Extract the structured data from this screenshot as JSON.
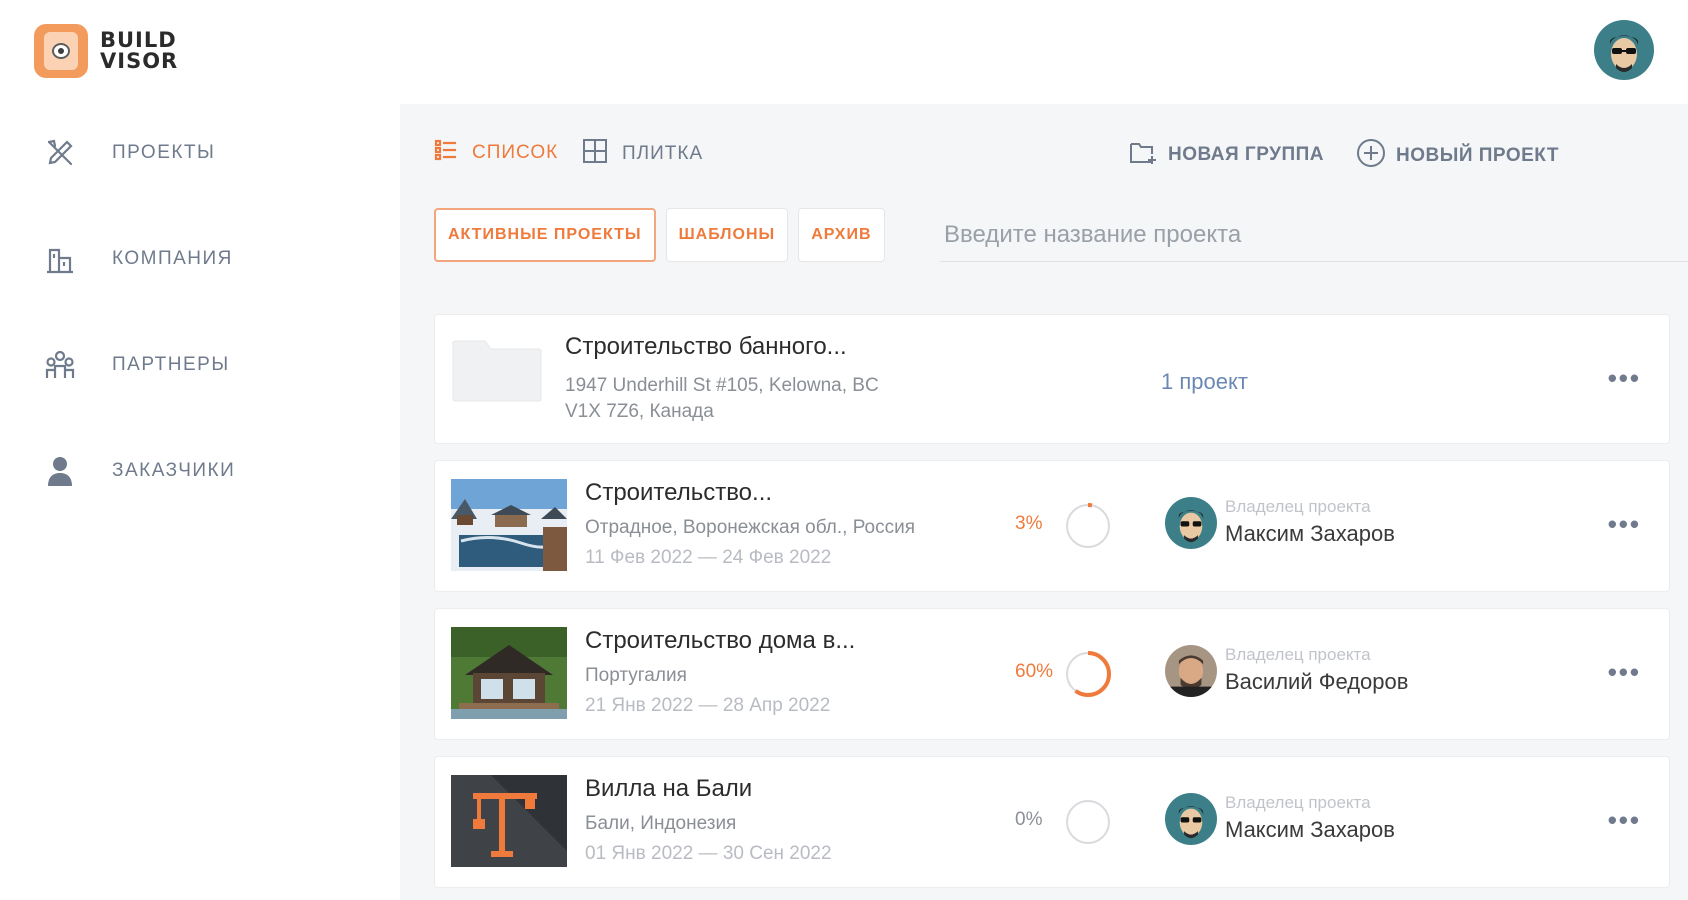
{
  "logo": {
    "line1": "BUILD",
    "line2": "VISOR"
  },
  "sidebar": {
    "items": [
      {
        "label": "ПРОЕКТЫ",
        "icon": "tools-icon"
      },
      {
        "label": "КОМПАНИЯ",
        "icon": "building-icon"
      },
      {
        "label": "ПАРТНЕРЫ",
        "icon": "partners-icon"
      },
      {
        "label": "ЗАКАЗЧИКИ",
        "icon": "customer-icon"
      }
    ]
  },
  "toolbar": {
    "list_label": "СПИСОК",
    "tiles_label": "ПЛИТКА",
    "new_group_label": "НОВАЯ ГРУППА",
    "new_project_label": "НОВЫЙ ПРОЕКТ"
  },
  "filters": [
    {
      "label": "АКТИВНЫЕ ПРОЕКТЫ",
      "active": true
    },
    {
      "label": "ШАБЛОНЫ",
      "active": false
    },
    {
      "label": "АРХИВ",
      "active": false
    }
  ],
  "search": {
    "placeholder": "Введите название проекта",
    "value": ""
  },
  "group": {
    "title": "Строительство банного...",
    "address_line1": "1947 Underhill St #105, Kelowna, BC",
    "address_line2": "V1X 7Z6, Канада",
    "count": "1 проект"
  },
  "projects": [
    {
      "title": "Строительство...",
      "location": "Отрадное, Воронежская обл., Россия",
      "dates": "11 Фев 2022 — 24 Фев 2022",
      "progress_text": "3%",
      "progress": 3,
      "progress_color": "#ef7a3c",
      "owner_label": "Владелец проекта",
      "owner_name": "Максим Захаров"
    },
    {
      "title": "Строительство дома в...",
      "location": "Португалия",
      "dates": "21 Янв 2022 — 28 Апр 2022",
      "progress_text": "60%",
      "progress": 60,
      "progress_color": "#ef7a3c",
      "owner_label": "Владелец проекта",
      "owner_name": "Василий  Федоров"
    },
    {
      "title": "Вилла на Бали",
      "location": "Бали, Индонезия",
      "dates": "01 Янв 2022 — 30 Сен 2022",
      "progress_text": "0%",
      "progress": 0,
      "progress_color": "#8a8f96",
      "owner_label": "Владелец проекта",
      "owner_name": "Максим Захаров"
    }
  ],
  "menu_glyph": "•••",
  "colors": {
    "accent": "#ef7a3c",
    "nav_text": "#6f7b8c",
    "link": "#6b88b5"
  }
}
